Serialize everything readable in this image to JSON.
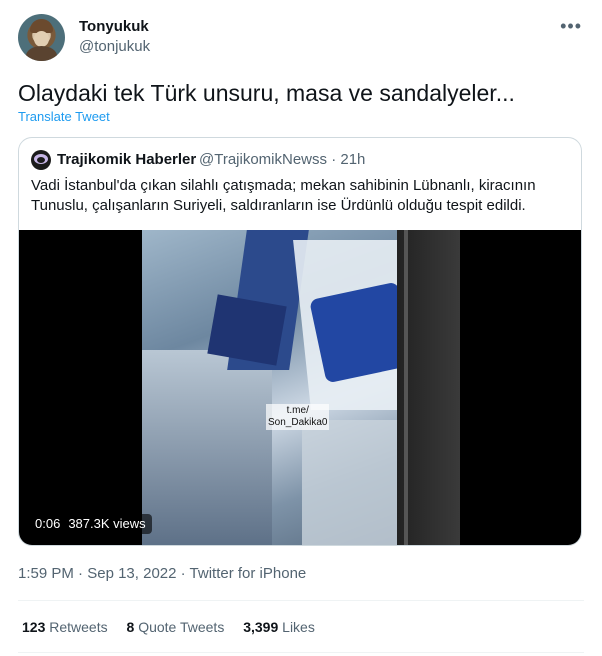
{
  "author": {
    "name": "Tonyukuk",
    "handle": "@tonjukuk"
  },
  "tweet": {
    "text": "Olaydaki tek Türk unsuru, masa ve sandalyeler...",
    "translate_label": "Translate Tweet"
  },
  "quoted_tweet": {
    "author_name": "Trajikomik Haberler",
    "author_handle": "@TrajikomikNewss",
    "separator": "·",
    "time": "21h",
    "text": "Vadi İstanbul'da çıkan silahlı çatışmada; mekan sahibinin Lübnanlı, kiracının Tunuslu, çalışanların Suriyeli, saldıranların ise Ürdünlü olduğu tespit edildi.",
    "video": {
      "watermark_line1": "t.me/",
      "watermark_line2": "Son_Dakika0",
      "duration": "0:06",
      "views": "387.3K views"
    }
  },
  "meta": {
    "time": "1:59 PM",
    "date": "Sep 13, 2022",
    "source": "Twitter for iPhone",
    "separator": "·"
  },
  "stats": {
    "retweets_count": "123",
    "retweets_label": "Retweets",
    "quotes_count": "8",
    "quotes_label": "Quote Tweets",
    "likes_count": "3,399",
    "likes_label": "Likes"
  },
  "icons": {
    "more": "more-options-icon"
  },
  "colors": {
    "link": "#1d9bf0",
    "secondary_text": "#536471",
    "border": "#cfd9de"
  }
}
